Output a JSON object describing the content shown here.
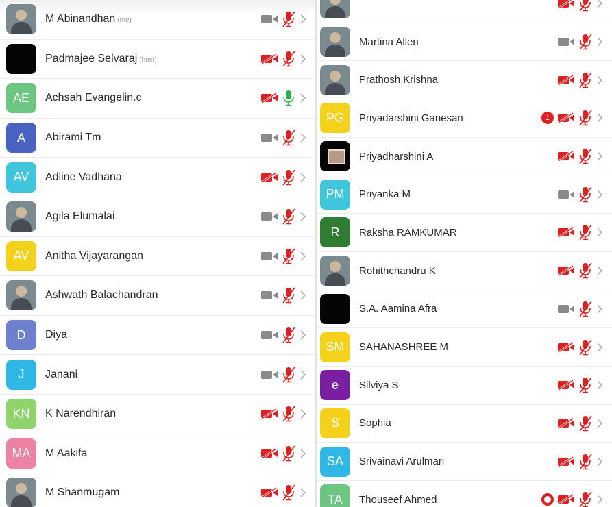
{
  "colors": {
    "mute_red": "#e02020",
    "video_gray": "#8a8a8a",
    "mic_green": "#2bb24c",
    "chevron": "#b0b0b0"
  },
  "left_column": [
    {
      "name": "M Abinandhan",
      "tag": "(me)",
      "avatar": {
        "type": "photo",
        "text": ""
      },
      "video": "on",
      "mic": "muted",
      "badge": ""
    },
    {
      "name": "Padmajee Selvaraj",
      "tag": "(host)",
      "avatar": {
        "type": "black",
        "text": ""
      },
      "video": "off",
      "mic": "muted",
      "badge": ""
    },
    {
      "name": "Achsah Evangelin.c",
      "tag": "",
      "avatar": {
        "type": "initials",
        "text": "AE",
        "color": "#6cc580"
      },
      "video": "off",
      "mic": "on",
      "badge": ""
    },
    {
      "name": "Abirami Tm",
      "tag": "",
      "avatar": {
        "type": "initials",
        "text": "A",
        "color": "#4a62c2"
      },
      "video": "on",
      "mic": "muted",
      "badge": ""
    },
    {
      "name": "Adline Vadhana",
      "tag": "",
      "avatar": {
        "type": "initials",
        "text": "AV",
        "color": "#3fc5dc"
      },
      "video": "off",
      "mic": "muted",
      "badge": ""
    },
    {
      "name": "Agila Elumalai",
      "tag": "",
      "avatar": {
        "type": "photo",
        "text": ""
      },
      "video": "on",
      "mic": "muted",
      "badge": ""
    },
    {
      "name": "Anitha Vijayarangan",
      "tag": "",
      "avatar": {
        "type": "initials",
        "text": "AV",
        "color": "#f4d21c"
      },
      "video": "on",
      "mic": "muted",
      "badge": ""
    },
    {
      "name": "Ashwath Balachandran",
      "tag": "",
      "avatar": {
        "type": "photo",
        "text": ""
      },
      "video": "on",
      "mic": "muted",
      "badge": ""
    },
    {
      "name": "Diya",
      "tag": "",
      "avatar": {
        "type": "initials",
        "text": "D",
        "color": "#6e7fce"
      },
      "video": "on",
      "mic": "muted",
      "badge": ""
    },
    {
      "name": "Janani",
      "tag": "",
      "avatar": {
        "type": "initials",
        "text": "J",
        "color": "#2fb8e6"
      },
      "video": "on",
      "mic": "muted",
      "badge": ""
    },
    {
      "name": "K Narendhiran",
      "tag": "",
      "avatar": {
        "type": "initials",
        "text": "KN",
        "color": "#8fd36c"
      },
      "video": "off",
      "mic": "muted",
      "badge": ""
    },
    {
      "name": "M Aakifa",
      "tag": "",
      "avatar": {
        "type": "initials",
        "text": "MA",
        "color": "#ec83a4"
      },
      "video": "off",
      "mic": "muted",
      "badge": ""
    },
    {
      "name": "M Shanmugam",
      "tag": "",
      "avatar": {
        "type": "photo",
        "text": ""
      },
      "video": "off",
      "mic": "muted",
      "badge": ""
    }
  ],
  "right_column": [
    {
      "name": "",
      "tag": "",
      "avatar": {
        "type": "photo",
        "text": ""
      },
      "video": "off",
      "mic": "muted",
      "badge": ""
    },
    {
      "name": "Martina Allen",
      "tag": "",
      "avatar": {
        "type": "photo",
        "text": ""
      },
      "video": "on",
      "mic": "muted",
      "badge": ""
    },
    {
      "name": "Prathosh Krishna",
      "tag": "",
      "avatar": {
        "type": "photo",
        "text": ""
      },
      "video": "off",
      "mic": "muted",
      "badge": ""
    },
    {
      "name": "Priyadarshini Ganesan",
      "tag": "",
      "avatar": {
        "type": "initials",
        "text": "PG",
        "color": "#f4d21c"
      },
      "video": "off",
      "mic": "muted",
      "badge": "1"
    },
    {
      "name": "Priyadharshini A",
      "tag": "",
      "avatar": {
        "type": "black-framed",
        "text": ""
      },
      "video": "off",
      "mic": "muted",
      "badge": ""
    },
    {
      "name": "Priyanka M",
      "tag": "",
      "avatar": {
        "type": "initials",
        "text": "PM",
        "color": "#3fc5dc"
      },
      "video": "on",
      "mic": "muted",
      "badge": ""
    },
    {
      "name": "Raksha RAMKUMAR",
      "tag": "",
      "avatar": {
        "type": "initials",
        "text": "R",
        "color": "#2e7d32"
      },
      "video": "off",
      "mic": "muted",
      "badge": ""
    },
    {
      "name": "Rohithchandru K",
      "tag": "",
      "avatar": {
        "type": "photo",
        "text": ""
      },
      "video": "off",
      "mic": "muted",
      "badge": ""
    },
    {
      "name": "S.A. Aamina Afra",
      "tag": "",
      "avatar": {
        "type": "black",
        "text": ""
      },
      "video": "on",
      "mic": "muted",
      "badge": ""
    },
    {
      "name": "SAHANASHREE M",
      "tag": "",
      "avatar": {
        "type": "initials",
        "text": "SM",
        "color": "#f4d21c"
      },
      "video": "off",
      "mic": "muted",
      "badge": ""
    },
    {
      "name": "Silviya S",
      "tag": "",
      "avatar": {
        "type": "initials",
        "text": "e",
        "color": "#7b1fa2"
      },
      "video": "off",
      "mic": "muted",
      "badge": ""
    },
    {
      "name": "Sophia",
      "tag": "",
      "avatar": {
        "type": "initials",
        "text": "S",
        "color": "#f4d21c"
      },
      "video": "off",
      "mic": "muted",
      "badge": ""
    },
    {
      "name": "Srivainavi Arulmari",
      "tag": "",
      "avatar": {
        "type": "initials",
        "text": "SA",
        "color": "#2fb8e6"
      },
      "video": "off",
      "mic": "muted",
      "badge": ""
    },
    {
      "name": "Thouseef Ahmed",
      "tag": "",
      "avatar": {
        "type": "initials",
        "text": "TA",
        "color": "#6cc580"
      },
      "video": "off",
      "mic": "muted",
      "badge": "ring"
    }
  ]
}
